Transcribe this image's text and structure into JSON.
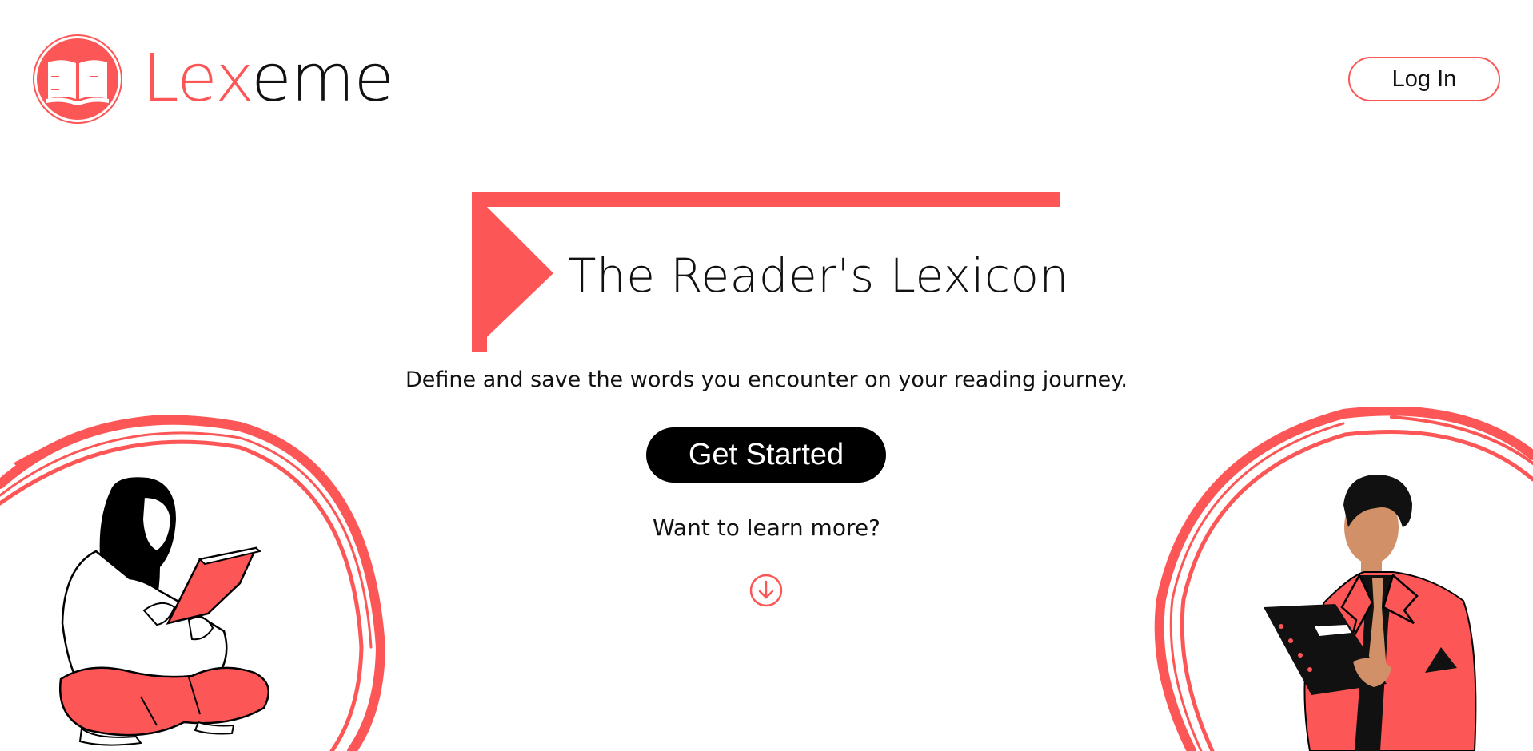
{
  "brand": {
    "name_accent": "Lex",
    "name_rest": "eme",
    "logo_icon": "open-book-icon",
    "accent_color": "#fd5656"
  },
  "header": {
    "login_label": "Log In"
  },
  "hero": {
    "title": "The Reader's Lexicon",
    "subtitle": "Define and save the words you encounter on your reading journey.",
    "cta_label": "Get Started",
    "learn_more": "Want to learn more?",
    "scroll_icon": "arrow-down-circle-icon"
  },
  "illustrations": {
    "left": "woman-reading-book-illustration",
    "right": "man-holding-notebook-illustration"
  }
}
